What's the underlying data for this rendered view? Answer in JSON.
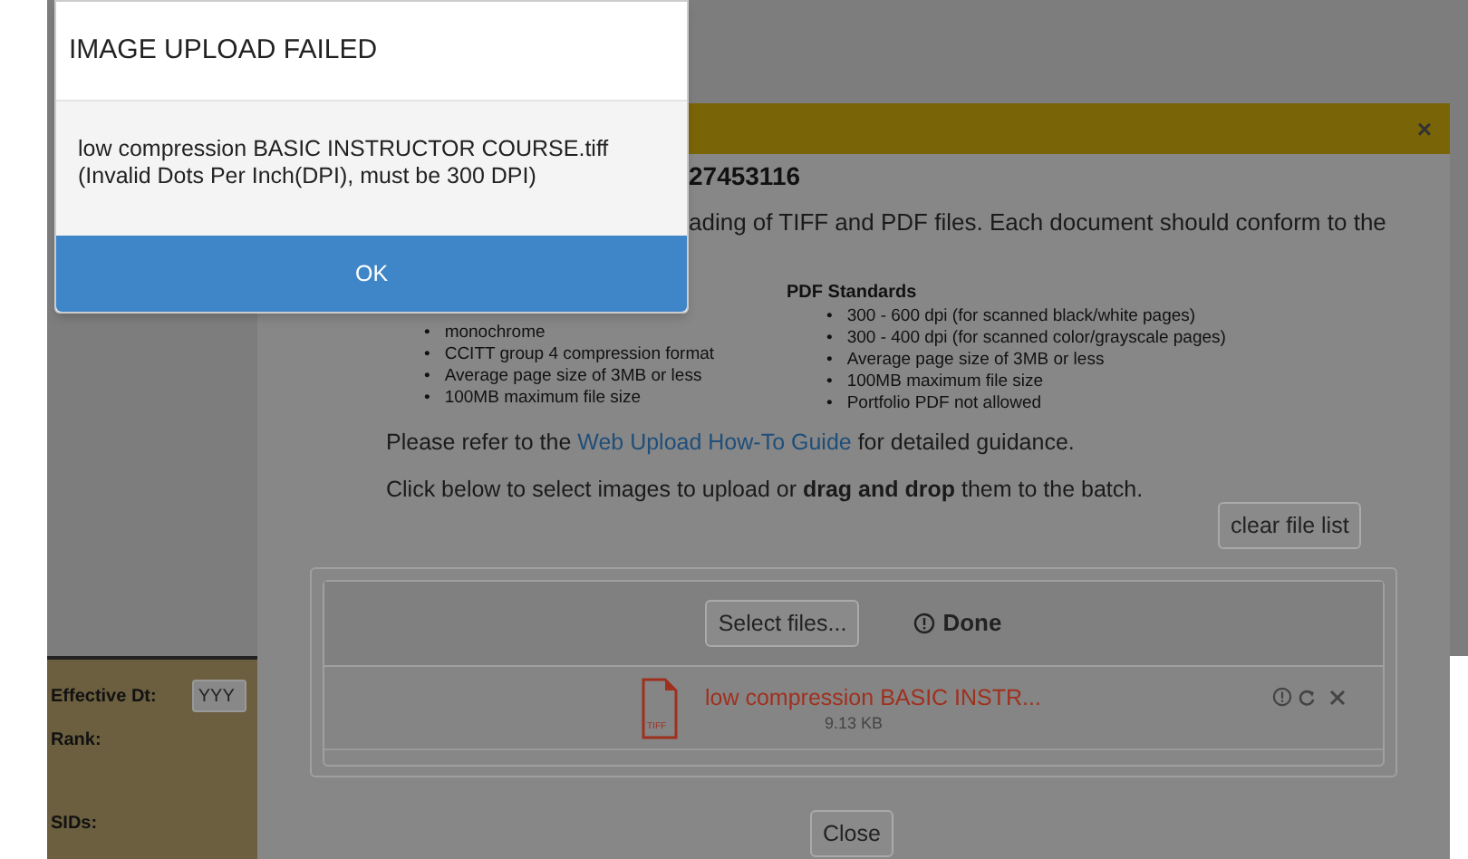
{
  "background_form": {
    "labels": [
      "Effective Dt:",
      "Rank:",
      "SIDs:"
    ],
    "date_field": {
      "value": "YYY"
    }
  },
  "upload_dialog": {
    "close": "×",
    "heading": "27453116",
    "intro": "ading of TIFF and PDF files. Each document should conform to the",
    "tiff_standards": [
      "monochrome",
      "CCITT group 4 compression format",
      "Average page size of 3MB or less",
      "100MB maximum file size"
    ],
    "pdf_standards": {
      "title": "PDF Standards",
      "items": [
        "300 - 600 dpi (for scanned black/white pages)",
        "300 - 400 dpi (for scanned color/grayscale pages)",
        "Average page size of 3MB or less",
        "100MB maximum file size",
        "Portfolio PDF not allowed"
      ]
    },
    "guide": {
      "before": "Please refer to the ",
      "link": "Web Upload How-To Guide",
      "after": " for detailed guidance."
    },
    "instructions": "Click below to select images to upload or **drag and drop** them to the batch.",
    "clear_button": "clear file list",
    "select_button": "Select files...",
    "status": "Done",
    "files": [
      {
        "name": "low compression BASIC INSTR...",
        "size": "9.13 KB",
        "type": "TIFF",
        "failed": true
      }
    ],
    "close_button": "Close",
    "bullet": "•"
  },
  "error_dialog": {
    "title": "IMAGE UPLOAD FAILED",
    "message": [
      "low compression BASIC INSTRUCTOR COURSE.tiff",
      "(Invalid Dots Per Inch(DPI), must be 300 DPI)"
    ],
    "ok": "OK"
  }
}
